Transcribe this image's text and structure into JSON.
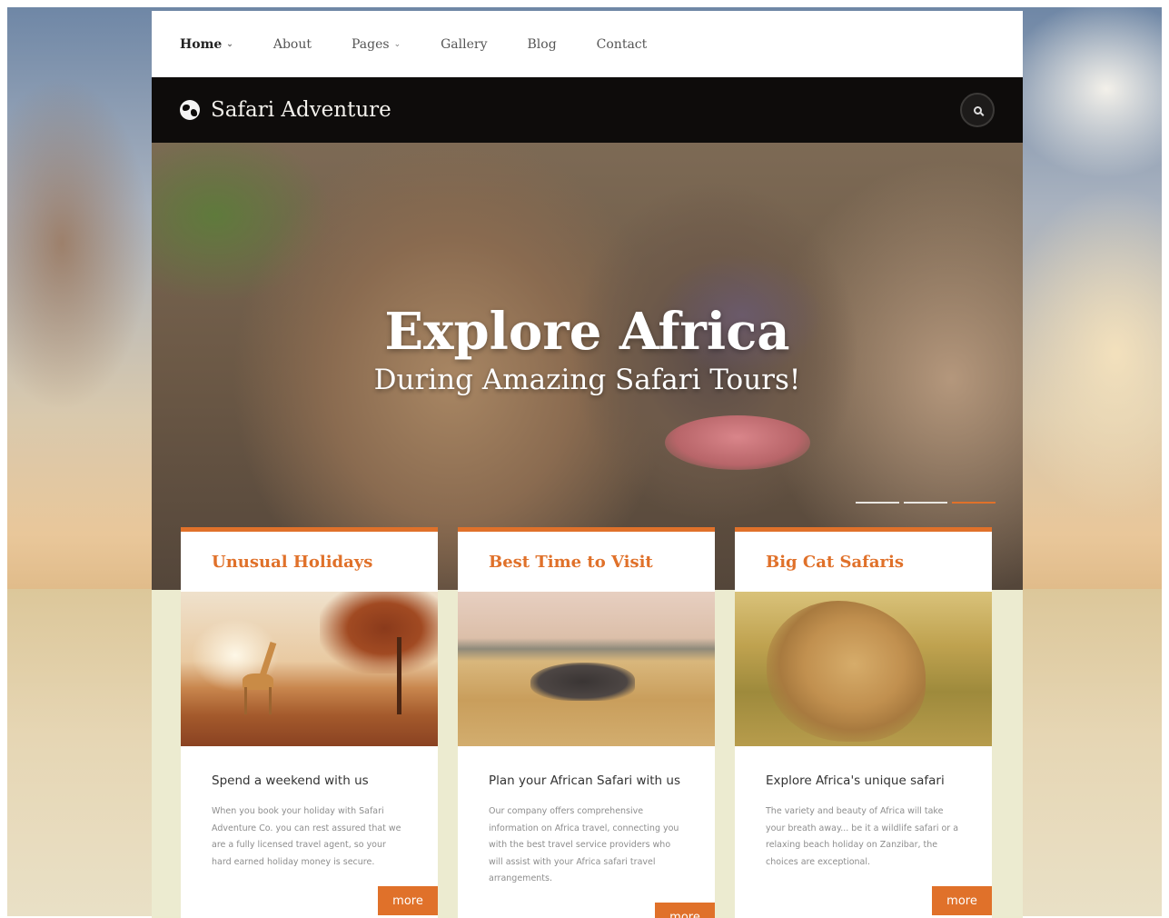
{
  "nav": {
    "items": [
      {
        "label": "Home",
        "dropdown": true,
        "active": true
      },
      {
        "label": "About",
        "dropdown": false,
        "active": false
      },
      {
        "label": "Pages",
        "dropdown": true,
        "active": false
      },
      {
        "label": "Gallery",
        "dropdown": false,
        "active": false
      },
      {
        "label": "Blog",
        "dropdown": false,
        "active": false
      },
      {
        "label": "Contact",
        "dropdown": false,
        "active": false
      }
    ]
  },
  "brand": {
    "name": "Safari Adventure",
    "icon": "globe-icon"
  },
  "search": {
    "icon": "search-icon"
  },
  "hero": {
    "title": "Explore Africa",
    "subtitle": "During Amazing Safari Tours!",
    "slides_count": 3,
    "active_slide": 3
  },
  "colors": {
    "accent": "#e0712a",
    "brand_bar": "#0e0c0b"
  },
  "cards": [
    {
      "title": "Unusual Holidays",
      "heading": "Spend a weekend with us",
      "text": "When you book your holiday with Safari Adventure Co. you can rest assured that we are a fully licensed travel agent, so your hard earned holiday money is secure.",
      "button": "more"
    },
    {
      "title": "Best Time to Visit",
      "heading": "Plan your African Safari with us",
      "text": "Our company offers comprehensive information on Africa travel, connecting you with the best travel service providers who will assist with your Africa safari travel arrangements.",
      "button": "more"
    },
    {
      "title": "Big Cat Safaris",
      "heading": "Explore Africa's unique safari",
      "text": "The variety and beauty of Africa will take your breath away... be it a wildlife safari or a relaxing beach holiday on Zanzibar, the choices are exceptional.",
      "button": "more"
    }
  ]
}
